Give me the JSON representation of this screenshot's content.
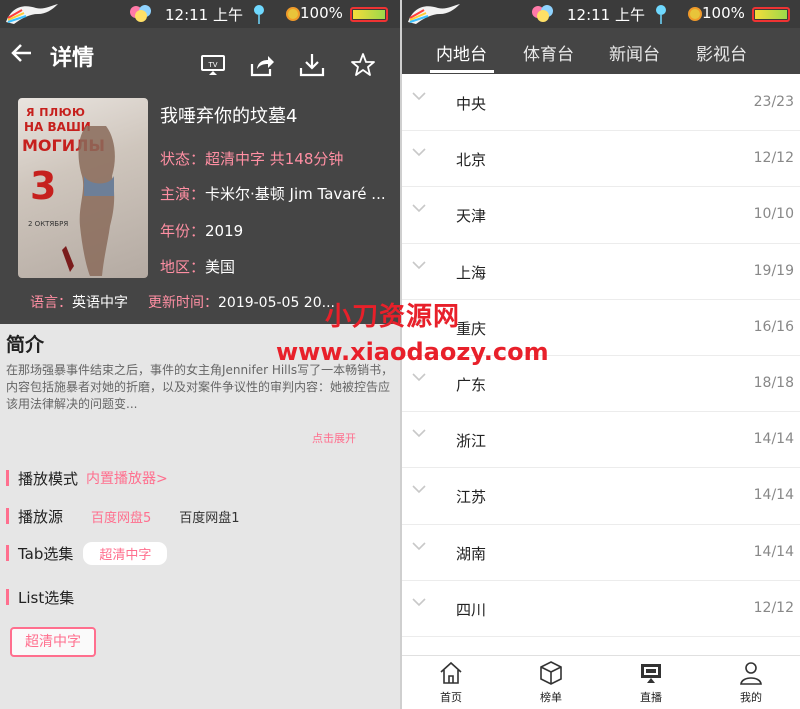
{
  "status_bar": {
    "time": "12:11 上午",
    "battery": "100%",
    "battery_level": 1.0
  },
  "left": {
    "header": {
      "title": "详情",
      "icons": [
        "back-icon",
        "tv-cast-icon",
        "share-icon",
        "download-icon",
        "star-icon"
      ]
    },
    "movie": {
      "poster_text_1": "Я ПЛЮЮ",
      "poster_text_2": "НА ВАШИ",
      "poster_text_3": "МОГИЛЫ",
      "poster_number": "3",
      "poster_date": "2 ОКТЯБРЯ",
      "title": "我唾弃你的坟墓4",
      "status_key": "状态：",
      "status_val": "超清中字 共148分钟",
      "cast_key": "主演：",
      "cast_val": "卡米尔·基顿 Jim Tavaré ...",
      "year_key": "年份：",
      "year_val": "2019",
      "region_key": "地区：",
      "region_val": "美国",
      "lang_key": "语言：",
      "lang_val": "英语中字",
      "update_key": "更新时间：",
      "update_val": "2019-05-05 20..."
    },
    "intro": {
      "heading": "简介",
      "text": "在那场强暴事件结束之后，事件的女主角Jennifer Hills写了一本畅销书，内容包括施暴者对她的折磨，以及对案件争议性的审判内容：她被控告应该用法律解决的问题变...",
      "expand": "点击展开"
    },
    "play_mode": {
      "label": "播放模式",
      "value": "内置播放器>"
    },
    "source": {
      "label": "播放源",
      "options": [
        "百度网盘5",
        "百度网盘1"
      ]
    },
    "tab_select": {
      "label": "Tab选集",
      "chip": "超清中字"
    },
    "list_select": {
      "label": "List选集",
      "button": "超清中字"
    }
  },
  "right": {
    "tabs": [
      "内地台",
      "体育台",
      "新闻台",
      "影视台"
    ],
    "active_tab": 0,
    "channels": [
      {
        "name": "中央",
        "count": "23/23"
      },
      {
        "name": "北京",
        "count": "12/12"
      },
      {
        "name": "天津",
        "count": "10/10"
      },
      {
        "name": "上海",
        "count": "19/19"
      },
      {
        "name": "重庆",
        "count": "16/16"
      },
      {
        "name": "广东",
        "count": "18/18"
      },
      {
        "name": "浙江",
        "count": "14/14"
      },
      {
        "name": "江苏",
        "count": "14/14"
      },
      {
        "name": "湖南",
        "count": "14/14"
      },
      {
        "name": "四川",
        "count": "12/12"
      }
    ],
    "bottom_nav": [
      {
        "label": "首页",
        "icon": "home-icon"
      },
      {
        "label": "榜单",
        "icon": "box-icon"
      },
      {
        "label": "直播",
        "icon": "tv-live-icon"
      },
      {
        "label": "我的",
        "icon": "person-icon"
      }
    ]
  },
  "watermark": {
    "line1": "小刀资源网",
    "line2": "www.xiaodaozy.com"
  },
  "colors": {
    "accent": "#ff6f8e",
    "header": "#454545",
    "watermark": "#e8202a"
  }
}
